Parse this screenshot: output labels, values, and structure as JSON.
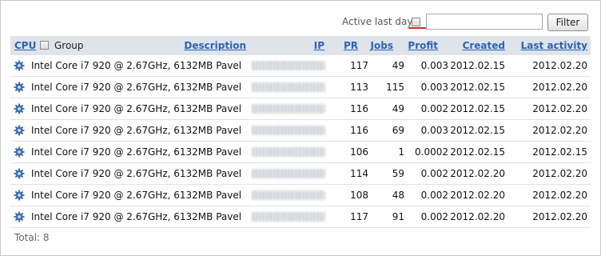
{
  "filter": {
    "active_label": "Active last day",
    "input_value": "",
    "button_label": "Filter"
  },
  "columns": {
    "cpu": "CPU",
    "group": "Group",
    "description": "Description",
    "ip": "IP",
    "pr": "PR",
    "jobs": "Jobs",
    "profit": "Profit",
    "created": "Created",
    "last_activity": "Last activity"
  },
  "rows": [
    {
      "description": "Intel Core i7 920 @ 2.67GHz, 6132MB Pavel",
      "pr": "117",
      "jobs": "49",
      "profit": "0.003",
      "created": "2012.02.15",
      "last_activity": "2012.02.20"
    },
    {
      "description": "Intel Core i7 920 @ 2.67GHz, 6132MB Pavel",
      "pr": "113",
      "jobs": "115",
      "profit": "0.003",
      "created": "2012.02.15",
      "last_activity": "2012.02.20"
    },
    {
      "description": "Intel Core i7 920 @ 2.67GHz, 6132MB Pavel",
      "pr": "116",
      "jobs": "49",
      "profit": "0.002",
      "created": "2012.02.15",
      "last_activity": "2012.02.20"
    },
    {
      "description": "Intel Core i7 920 @ 2.67GHz, 6132MB Pavel",
      "pr": "116",
      "jobs": "69",
      "profit": "0.003",
      "created": "2012.02.15",
      "last_activity": "2012.02.20"
    },
    {
      "description": "Intel Core i7 920 @ 2.67GHz, 6132MB Pavel",
      "pr": "106",
      "jobs": "1",
      "profit": "0.0002",
      "created": "2012.02.15",
      "last_activity": "2012.02.15"
    },
    {
      "description": "Intel Core i7 920 @ 2.67GHz, 6132MB Pavel",
      "pr": "114",
      "jobs": "59",
      "profit": "0.002",
      "created": "2012.02.20",
      "last_activity": "2012.02.20"
    },
    {
      "description": "Intel Core i7 920 @ 2.67GHz, 6132MB Pavel",
      "pr": "108",
      "jobs": "48",
      "profit": "0.002",
      "created": "2012.02.20",
      "last_activity": "2012.02.20"
    },
    {
      "description": "Intel Core i7 920 @ 2.67GHz, 6132MB Pavel",
      "pr": "117",
      "jobs": "91",
      "profit": "0.002",
      "created": "2012.02.20",
      "last_activity": "2012.02.20"
    }
  ],
  "row_icon": "gear-icon",
  "ip_display": "blurred",
  "total": "Total: 8",
  "colors": {
    "header_bg": "#dfe3ea",
    "link": "#2c63b8",
    "marker": "#d62a2a"
  }
}
